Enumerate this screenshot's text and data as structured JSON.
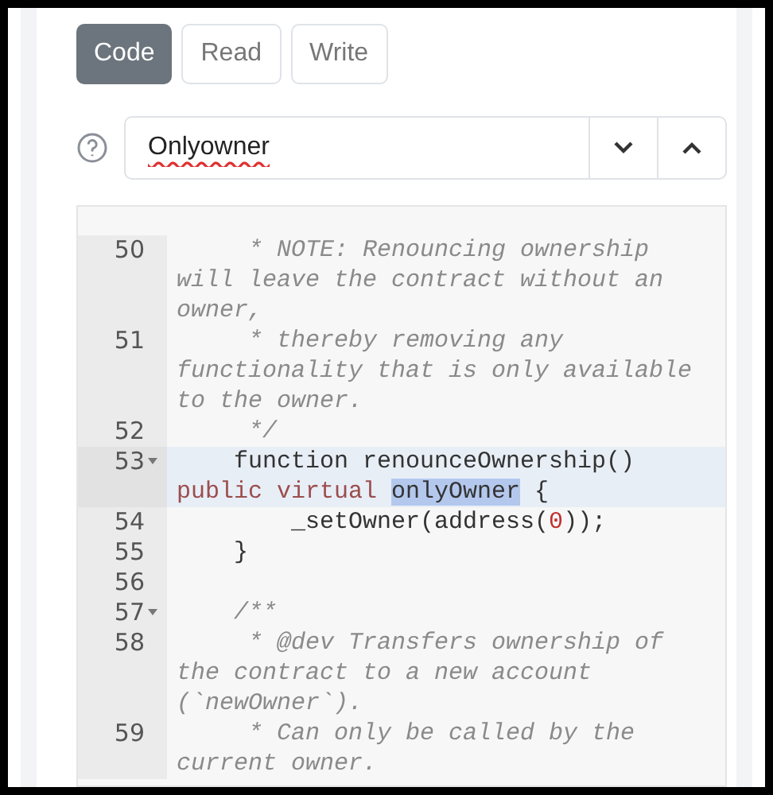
{
  "tabs": [
    {
      "label": "Code",
      "selected": true
    },
    {
      "label": "Read",
      "selected": false
    },
    {
      "label": "Write",
      "selected": false
    }
  ],
  "search": {
    "value": "Onlyowner",
    "misspelled": true
  },
  "code_lines": [
    {
      "number": "50",
      "foldable": false,
      "active": false,
      "segments": [
        {
          "kind": "comment",
          "text": "     * NOTE: Renouncing ownership will leave the contract without an owner,"
        }
      ]
    },
    {
      "number": "51",
      "foldable": false,
      "active": false,
      "segments": [
        {
          "kind": "comment",
          "text": "     * thereby removing any functionality that is only available to the owner."
        }
      ]
    },
    {
      "number": "52",
      "foldable": false,
      "active": false,
      "segments": [
        {
          "kind": "comment",
          "text": "     */"
        }
      ]
    },
    {
      "number": "53",
      "foldable": true,
      "active": true,
      "segments": [
        {
          "kind": "plain",
          "text": "    function renounceOwnership() "
        },
        {
          "kind": "keyword",
          "text": "public virtual "
        },
        {
          "kind": "match",
          "text": "onlyOwner"
        },
        {
          "kind": "plain",
          "text": " {"
        }
      ]
    },
    {
      "number": "54",
      "foldable": false,
      "active": false,
      "segments": [
        {
          "kind": "plain",
          "text": "        _setOwner(address("
        },
        {
          "kind": "number",
          "text": "0"
        },
        {
          "kind": "plain",
          "text": "));"
        }
      ]
    },
    {
      "number": "55",
      "foldable": false,
      "active": false,
      "segments": [
        {
          "kind": "plain",
          "text": "    }"
        }
      ]
    },
    {
      "number": "56",
      "foldable": false,
      "active": false
    },
    {
      "number": "57",
      "foldable": true,
      "active": false,
      "segments": [
        {
          "kind": "comment",
          "text": "    /**"
        }
      ]
    },
    {
      "number": "58",
      "foldable": false,
      "active": false,
      "segments": [
        {
          "kind": "comment",
          "text": "     * @dev Transfers ownership of the contract to a new account (`newOwner`)."
        }
      ]
    },
    {
      "number": "59",
      "foldable": false,
      "active": false,
      "segments": [
        {
          "kind": "comment",
          "text": "     * Can only be called by the current owner."
        }
      ]
    }
  ]
}
